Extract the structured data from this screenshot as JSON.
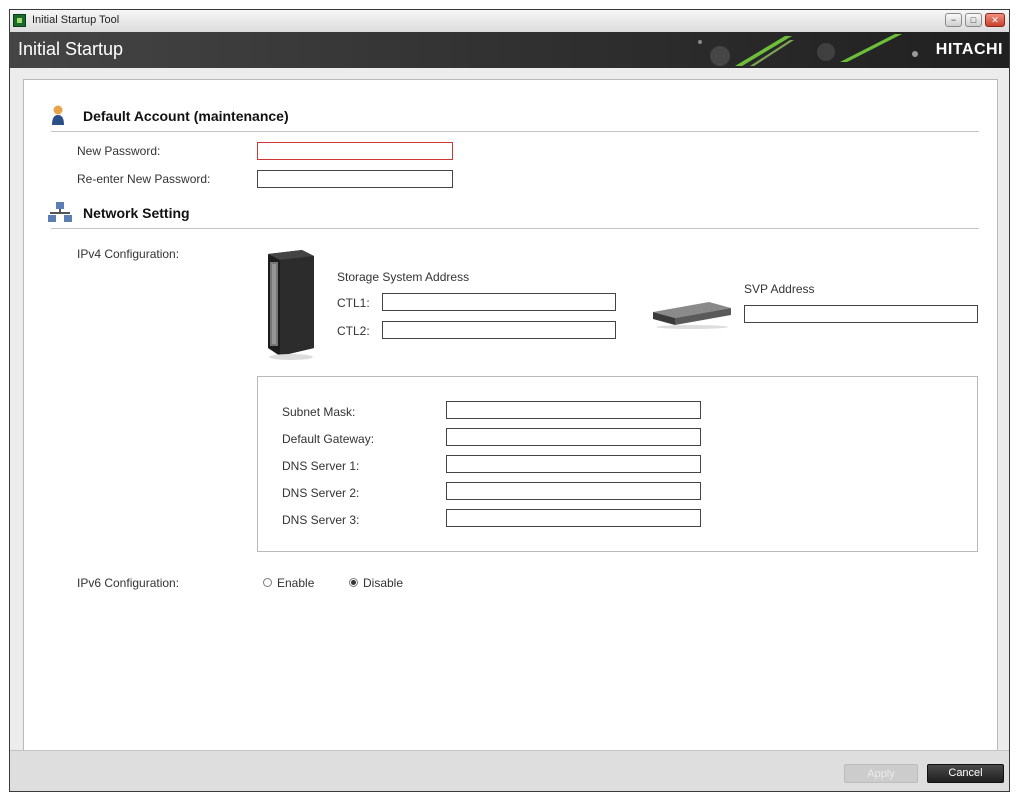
{
  "window": {
    "title": "Initial Startup Tool",
    "header_title": "Initial Startup",
    "brand": "HITACHI",
    "controls": {
      "minimize": "−",
      "maximize": "□",
      "close": "✕"
    }
  },
  "account_section": {
    "title": "Default Account (maintenance)",
    "icon": "user-icon",
    "new_password_label": "New Password:",
    "new_password_value": "",
    "reenter_label": "Re-enter New Password:",
    "reenter_value": ""
  },
  "network_section": {
    "title": "Network Setting",
    "icon": "network-icon",
    "ipv4_label": "IPv4 Configuration:",
    "storage_system_label": "Storage System Address",
    "ctl1_label": "CTL1:",
    "ctl1_value": "",
    "ctl2_label": "CTL2:",
    "ctl2_value": "",
    "svp_label": "SVP Address",
    "svp_value": "",
    "subnet_mask_label": "Subnet Mask:",
    "subnet_mask_value": "",
    "default_gateway_label": "Default Gateway:",
    "default_gateway_value": "",
    "dns1_label": "DNS Server 1:",
    "dns1_value": "",
    "dns2_label": "DNS Server 2:",
    "dns2_value": "",
    "dns3_label": "DNS Server 3:",
    "dns3_value": "",
    "ipv6_label": "IPv6 Configuration:",
    "ipv6_enable_label": "Enable",
    "ipv6_disable_label": "Disable",
    "ipv6_selected": "Disable"
  },
  "footer": {
    "apply_label": "Apply",
    "cancel_label": "Cancel"
  },
  "colors": {
    "header_bg": "#2f2f2f",
    "error_border": "#d13535",
    "brand_green": "#6dbf3a"
  }
}
